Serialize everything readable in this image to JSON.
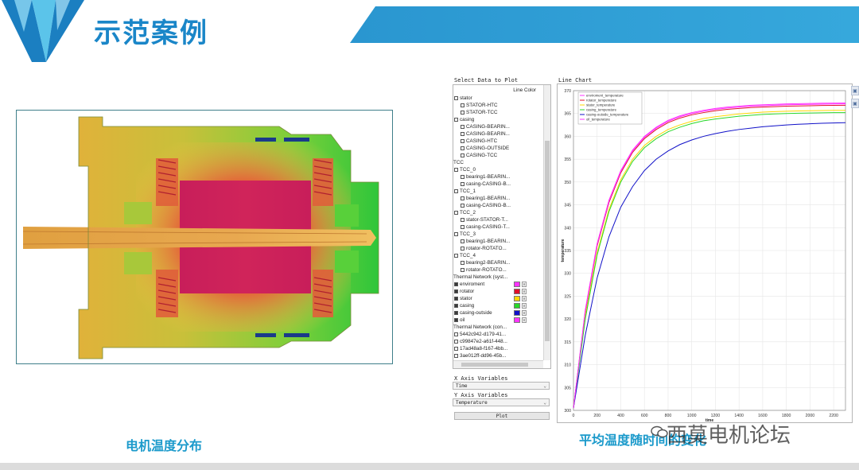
{
  "slide": {
    "title": "示范案例",
    "left_caption": "电机温度分布",
    "right_caption": "平均温度随时间的变化",
    "watermark": "西莫电机论坛",
    "colors": {
      "title": "#1a86c8",
      "banner": "#2a96d0",
      "caption": "#1b9acb",
      "logo_dark": "#1b7fc1",
      "logo_light": "#5bc4ea"
    }
  },
  "panel": {
    "select_header": "Select Data to Plot",
    "line_color_header": "Line Color",
    "tree": [
      {
        "label": "stator",
        "level": 0,
        "checked": false
      },
      {
        "label": "STATOR-HTC",
        "level": 1,
        "checked": false
      },
      {
        "label": "STATOR-TCC",
        "level": 1,
        "checked": false
      },
      {
        "label": "casing",
        "level": 0,
        "checked": false
      },
      {
        "label": "CASING-BEARIN...",
        "level": 1,
        "checked": false
      },
      {
        "label": "CASING-BEARIN...",
        "level": 1,
        "checked": false
      },
      {
        "label": "CASING-HTC",
        "level": 1,
        "checked": false
      },
      {
        "label": "CASING-OUTSIDE",
        "level": 1,
        "checked": false
      },
      {
        "label": "CASING-TCC",
        "level": 1,
        "checked": false
      },
      {
        "label": "TCC",
        "level": -1,
        "checked": null
      },
      {
        "label": "TCC_0",
        "level": 0,
        "checked": false
      },
      {
        "label": "bearing1-BEARIN...",
        "level": 1,
        "checked": false
      },
      {
        "label": "casing-CASING-B...",
        "level": 1,
        "checked": false
      },
      {
        "label": "TCC_1",
        "level": 0,
        "checked": false
      },
      {
        "label": "bearing1-BEARIN...",
        "level": 1,
        "checked": false
      },
      {
        "label": "casing-CASING-B...",
        "level": 1,
        "checked": false
      },
      {
        "label": "TCC_2",
        "level": 0,
        "checked": false
      },
      {
        "label": "stator-STATOR-T...",
        "level": 1,
        "checked": false
      },
      {
        "label": "casing-CASING-T...",
        "level": 1,
        "checked": false
      },
      {
        "label": "TCC_3",
        "level": 0,
        "checked": false
      },
      {
        "label": "bearing1-BEARIN...",
        "level": 1,
        "checked": false
      },
      {
        "label": "rotator-ROTATO...",
        "level": 1,
        "checked": false
      },
      {
        "label": "TCC_4",
        "level": 0,
        "checked": false
      },
      {
        "label": "bearing2-BEARIN...",
        "level": 1,
        "checked": false
      },
      {
        "label": "rotator-ROTATO...",
        "level": 1,
        "checked": false
      },
      {
        "label": "Thermal Network (syst...",
        "level": -1,
        "checked": null
      },
      {
        "label": "enviroment",
        "level": 0,
        "checked": true,
        "color": "#ff33ff"
      },
      {
        "label": "rotator",
        "level": 0,
        "checked": true,
        "color": "#e0102a"
      },
      {
        "label": "stator",
        "level": 0,
        "checked": true,
        "color": "#ffd700"
      },
      {
        "label": "casing",
        "level": 0,
        "checked": true,
        "color": "#2ad82a"
      },
      {
        "label": "casing-outside",
        "level": 0,
        "checked": true,
        "color": "#1010c8"
      },
      {
        "label": "oil",
        "level": 0,
        "checked": true,
        "color": "#ff33ff"
      },
      {
        "label": "Thermal Network (con...",
        "level": -1,
        "checked": null
      },
      {
        "label": "5442c942-d179-41...",
        "level": 0,
        "checked": false
      },
      {
        "label": "c99847e2-a61f-448...",
        "level": 0,
        "checked": false
      },
      {
        "label": "17ad48a8-f167-4bb...",
        "level": 0,
        "checked": false
      },
      {
        "label": "3ae012ff-dd96-45b...",
        "level": 0,
        "checked": false
      }
    ],
    "x_axis_label": "X Axis Variables",
    "x_axis_value": "Time",
    "y_axis_label": "Y Axis Variables",
    "y_axis_value": "Temperature",
    "plot_button": "Plot",
    "chart_header": "Line  Chart"
  },
  "chart_data": {
    "type": "line",
    "xlabel": "time",
    "ylabel": "temperature",
    "xlim": [
      0,
      2300
    ],
    "ylim": [
      300,
      370
    ],
    "xticks": [
      0,
      200,
      400,
      600,
      800,
      1000,
      1200,
      1400,
      1600,
      1800,
      2000,
      2200
    ],
    "yticks": [
      300,
      305,
      310,
      315,
      320,
      325,
      330,
      335,
      340,
      345,
      350,
      355,
      360,
      365,
      370
    ],
    "legend_position": "top-left",
    "legend": [
      "enviroment_temperature",
      "rotator_temperature",
      "stator_temperature",
      "casing_temperature",
      "casing-outside_temperature",
      "oil_temperature"
    ],
    "x": [
      0,
      100,
      200,
      300,
      400,
      500,
      600,
      700,
      800,
      900,
      1000,
      1100,
      1200,
      1300,
      1400,
      1500,
      1600,
      1700,
      1800,
      1900,
      2000,
      2100,
      2200,
      2300
    ],
    "series": [
      {
        "name": "enviroment_temperature",
        "color": "#ff33ff",
        "values": [
          300.5,
          322.0,
          336.5,
          346.0,
          352.5,
          357.0,
          360.0,
          362.0,
          363.5,
          364.5,
          365.2,
          365.7,
          366.1,
          366.4,
          366.6,
          366.8,
          366.9,
          367.0,
          367.1,
          367.15,
          367.2,
          367.25,
          367.28,
          367.3
        ]
      },
      {
        "name": "rotator_temperature",
        "color": "#e0102a",
        "values": [
          300.5,
          321.5,
          336.0,
          345.5,
          352.0,
          356.5,
          359.5,
          361.5,
          363.0,
          364.0,
          364.7,
          365.2,
          365.6,
          365.9,
          366.1,
          366.3,
          366.4,
          366.5,
          366.6,
          366.65,
          366.7,
          366.75,
          366.78,
          366.8
        ]
      },
      {
        "name": "stator_temperature",
        "color": "#ffd700",
        "values": [
          300.5,
          320.5,
          334.5,
          344.0,
          350.5,
          355.0,
          358.0,
          360.0,
          361.5,
          362.5,
          363.3,
          363.9,
          364.3,
          364.6,
          364.9,
          365.1,
          365.3,
          365.4,
          365.5,
          365.55,
          365.6,
          365.65,
          365.68,
          365.7
        ]
      },
      {
        "name": "casing_temperature",
        "color": "#2ad82a",
        "values": [
          300.5,
          320.0,
          334.0,
          343.5,
          350.0,
          354.5,
          357.5,
          359.5,
          361.0,
          362.0,
          362.8,
          363.4,
          363.8,
          364.1,
          364.4,
          364.6,
          364.8,
          364.9,
          365.0,
          365.05,
          365.1,
          365.15,
          365.18,
          365.2
        ]
      },
      {
        "name": "casing-outside_temperature",
        "color": "#1010c8",
        "values": [
          300.5,
          316.5,
          329.0,
          338.0,
          344.5,
          349.0,
          352.5,
          355.0,
          356.8,
          358.2,
          359.2,
          360.0,
          360.6,
          361.1,
          361.5,
          361.8,
          362.1,
          362.3,
          362.5,
          362.65,
          362.75,
          362.85,
          362.92,
          363.0
        ]
      },
      {
        "name": "oil_temperature",
        "color": "#ff33ff",
        "values": [
          300.5,
          321.8,
          336.3,
          345.8,
          352.3,
          356.8,
          359.8,
          361.8,
          363.3,
          364.3,
          365.0,
          365.5,
          365.9,
          366.2,
          366.4,
          366.6,
          366.7,
          366.8,
          366.9,
          366.95,
          367.0,
          367.05,
          367.08,
          367.1
        ]
      }
    ]
  }
}
